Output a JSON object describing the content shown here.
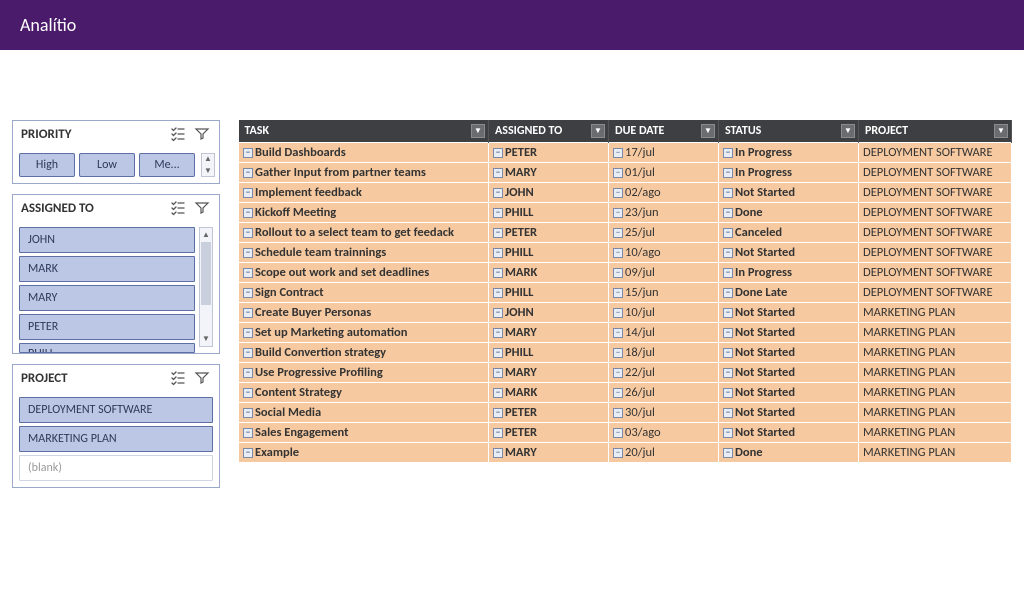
{
  "header": {
    "title": "Analítio"
  },
  "slicers": {
    "priority": {
      "title": "PRIORITY",
      "options": [
        "High",
        "Low",
        "Me..."
      ]
    },
    "assigned": {
      "title": "ASSIGNED TO",
      "options": [
        "JOHN",
        "MARK",
        "MARY",
        "PETER"
      ],
      "overflow_hint": "PHILL"
    },
    "project": {
      "title": "PROJECT",
      "options": [
        "DEPLOYMENT SOFTWARE",
        "MARKETING PLAN"
      ],
      "blank": "(blank)"
    }
  },
  "table": {
    "columns": {
      "task": "TASK",
      "assigned": "ASSIGNED TO",
      "due": "DUE DATE",
      "status": "STATUS",
      "project": "PROJECT"
    },
    "rows": [
      {
        "task": "Build Dashboards",
        "assigned": "PETER",
        "due": "17/jul",
        "status": "In Progress",
        "project": "DEPLOYMENT SOFTWARE"
      },
      {
        "task": "Gather Input from partner teams",
        "assigned": "MARY",
        "due": "01/jul",
        "status": "In Progress",
        "project": "DEPLOYMENT SOFTWARE"
      },
      {
        "task": "Implement feedback",
        "assigned": "JOHN",
        "due": "02/ago",
        "status": "Not Started",
        "project": "DEPLOYMENT SOFTWARE"
      },
      {
        "task": "Kickoff Meeting",
        "assigned": "PHILL",
        "due": "23/jun",
        "status": "Done",
        "project": "DEPLOYMENT SOFTWARE"
      },
      {
        "task": "Rollout to a select team to get feedack",
        "assigned": "PETER",
        "due": "25/jul",
        "status": "Canceled",
        "project": "DEPLOYMENT SOFTWARE"
      },
      {
        "task": "Schedule team trainnings",
        "assigned": "PHILL",
        "due": "10/ago",
        "status": "Not Started",
        "project": "DEPLOYMENT SOFTWARE"
      },
      {
        "task": "Scope out work and set deadlines",
        "assigned": "MARK",
        "due": "09/jul",
        "status": "In Progress",
        "project": "DEPLOYMENT SOFTWARE"
      },
      {
        "task": "Sign Contract",
        "assigned": "PHILL",
        "due": "15/jun",
        "status": "Done Late",
        "project": "DEPLOYMENT SOFTWARE"
      },
      {
        "task": "Create Buyer Personas",
        "assigned": "JOHN",
        "due": "10/jul",
        "status": "Not Started",
        "project": "MARKETING PLAN"
      },
      {
        "task": "Set up Marketing automation",
        "assigned": "MARY",
        "due": "14/jul",
        "status": "Not Started",
        "project": "MARKETING PLAN"
      },
      {
        "task": "Build Convertion strategy",
        "assigned": "PHILL",
        "due": "18/jul",
        "status": "Not Started",
        "project": "MARKETING PLAN"
      },
      {
        "task": "Use Progressive Profiling",
        "assigned": "MARY",
        "due": "22/jul",
        "status": "Not Started",
        "project": "MARKETING PLAN"
      },
      {
        "task": "Content Strategy",
        "assigned": "MARK",
        "due": "26/jul",
        "status": "Not Started",
        "project": "MARKETING PLAN"
      },
      {
        "task": "Social Media",
        "assigned": "PETER",
        "due": "30/jul",
        "status": "Not Started",
        "project": "MARKETING PLAN"
      },
      {
        "task": "Sales Engagement",
        "assigned": "PETER",
        "due": "03/ago",
        "status": "Not Started",
        "project": "MARKETING PLAN"
      },
      {
        "task": "Example",
        "assigned": "MARY",
        "due": "20/jul",
        "status": "Done",
        "project": "MARKETING PLAN"
      }
    ]
  }
}
